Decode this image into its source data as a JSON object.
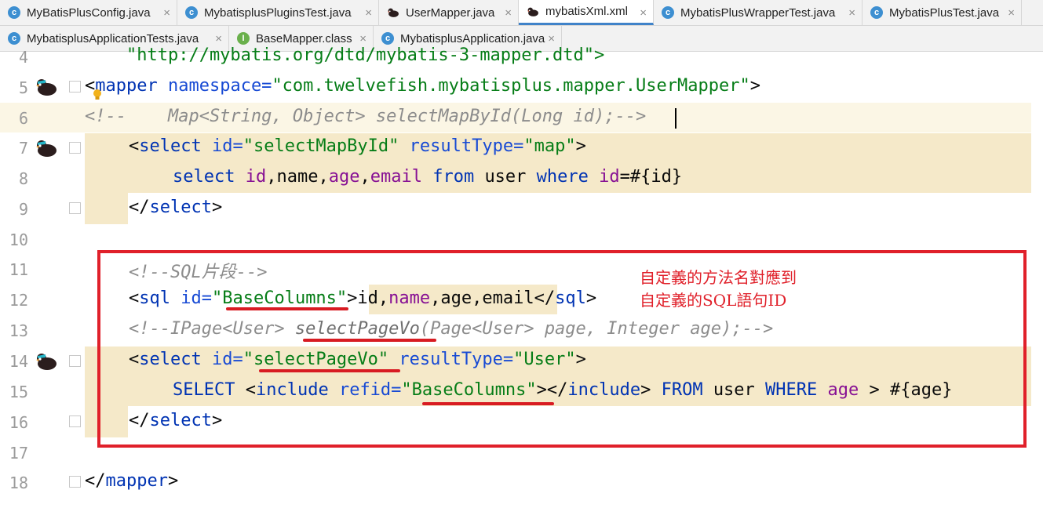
{
  "tabs_row1": [
    {
      "label": "MyBatisPlusConfig.java",
      "icon": "class-icon"
    },
    {
      "label": "MybatisplusPluginsTest.java",
      "icon": "class-icon"
    },
    {
      "label": "UserMapper.java",
      "icon": "mybatis-bird-icon"
    },
    {
      "label": "mybatisXml.xml",
      "icon": "mybatis-bird-icon"
    },
    {
      "label": "MybatisPlusWrapperTest.java",
      "icon": "class-icon"
    },
    {
      "label": "MybatisPlusTest.java",
      "icon": "class-icon"
    }
  ],
  "tabs_row2": [
    {
      "label": "MybatisplusApplicationTests.java",
      "icon": "class-icon"
    },
    {
      "label": "BaseMapper.class",
      "icon": "interface-icon"
    },
    {
      "label": "MybatisplusApplication.java",
      "icon": "class-icon"
    }
  ],
  "close_glyph": "×",
  "icon_letters": {
    "class": "c",
    "interface": "I"
  },
  "line_numbers": [
    "4",
    "5",
    "6",
    "7",
    "8",
    "9",
    "10",
    "11",
    "12",
    "13",
    "14",
    "15",
    "16",
    "17",
    "18"
  ],
  "code": {
    "l4": {
      "text": "    \"http://mybatis.org/dtd/mybatis-3-mapper.dtd\">"
    },
    "l5": {
      "lt": "<",
      "tag": "mapper",
      "attr": " namespace=",
      "val": "\"com.twelvefish.mybatisplus.mapper.UserMapper\"",
      "gt": ">"
    },
    "l6": {
      "comment": "<!--    Map<String, Object> selectMapById(Long id);-->"
    },
    "l7": {
      "lt": "<",
      "tag": "select",
      "attr1": " id=",
      "val1": "\"selectMapById\"",
      "attr2": " resultType=",
      "val2": "\"map\"",
      "gt": ">"
    },
    "l8": {
      "kw1": "select",
      "sp1": " ",
      "f1": "id",
      "c1": ",",
      "f2": "name",
      "c2": ",",
      "f3": "age",
      "c3": ",",
      "f4": "email",
      "sp2": " ",
      "kw2": "from",
      "sp3": " ",
      "tbl": "user",
      "sp4": " ",
      "kw3": "where",
      "sp5": " ",
      "f5": "id",
      "rest": "=#{id}"
    },
    "l9": {
      "close": "</",
      "tag": "select",
      "gt": ">"
    },
    "l11": {
      "comment": "<!--SQL片段-->"
    },
    "l12": {
      "lt": "<",
      "tag": "sql",
      "attr": " id=",
      "val": "\"BaseColumns\"",
      "gt": ">",
      "body1": "id,",
      "body2": "name",
      ",": ",",
      "body3": "age,email",
      "close": "</",
      "ctag": "sql",
      "cgt": ">"
    },
    "l13": {
      "c1": "<!--IPage<User> ",
      "c2": "selectPageVo",
      "c3": "(Page<User> page, Integer age);-->"
    },
    "l14": {
      "lt": "<",
      "tag": "select",
      "attr1": " id=",
      "val1": "\"selectPageVo\"",
      "attr2": " resultType=",
      "val2": "\"User\"",
      "gt": ">"
    },
    "l15": {
      "kw1": "SELECT",
      "sp1": " ",
      "lt": "<",
      "tag": "include",
      "attr": " refid=",
      "val": "\"BaseColumns\"",
      "gt": ">",
      "close": "</",
      "ctag": "include",
      "cgt": ">",
      "sp2": " ",
      "kw2": "FROM",
      "sp3": " ",
      "tbl": "user",
      "sp4": " ",
      "kw3": "WHERE",
      "sp5": " ",
      "f": "age",
      "rest": " > #{age}"
    },
    "l16": {
      "close": "</",
      "tag": "select",
      "gt": ">"
    },
    "l18": {
      "close": "</",
      "tag": "mapper",
      "gt": ">"
    }
  },
  "annotation": {
    "line1": "自定義的方法名對應到",
    "line2": "自定義的SQL語句ID"
  },
  "colors": {
    "tag": "#0033b3",
    "value": "#067d17",
    "comment": "#8c8c8c",
    "field": "#871094",
    "highlight": "#f5e9c9",
    "annotation": "#e0202a",
    "active_tab": "#4083c9"
  }
}
